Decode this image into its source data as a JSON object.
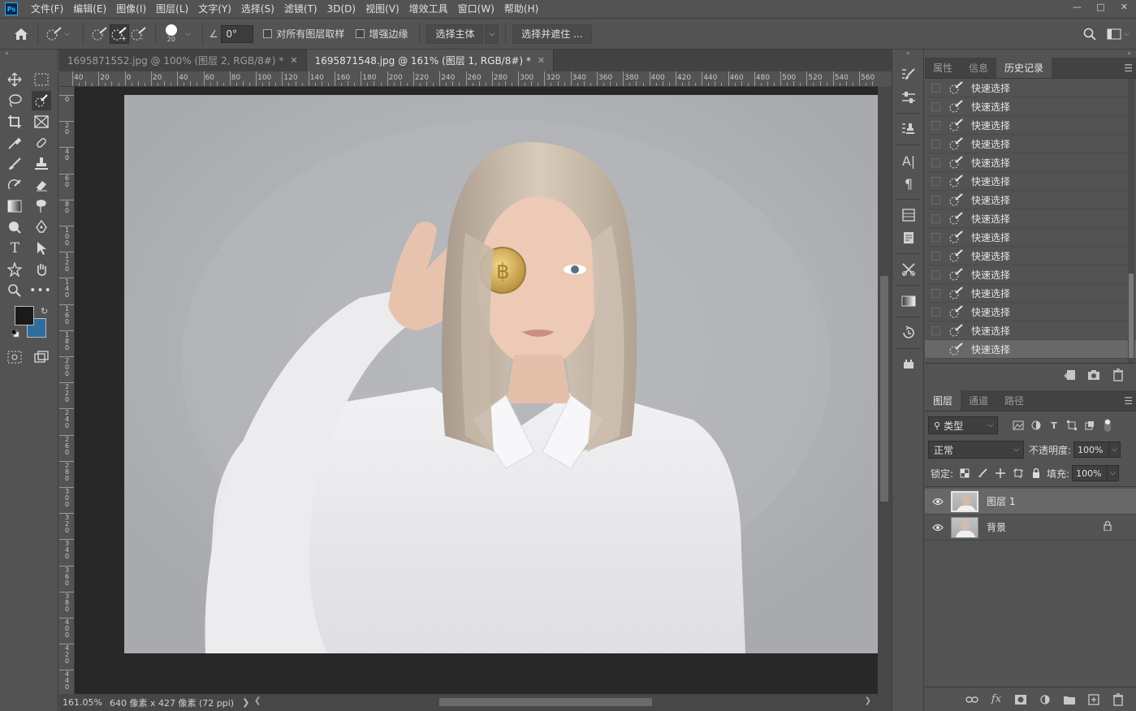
{
  "app": {
    "logo_text": "Ps",
    "menu": [
      "文件(F)",
      "编辑(E)",
      "图像(I)",
      "图层(L)",
      "文字(Y)",
      "选择(S)",
      "滤镜(T)",
      "3D(D)",
      "视图(V)",
      "增效工具",
      "窗口(W)",
      "帮助(H)"
    ]
  },
  "options": {
    "brush_size": "20",
    "angle": "0°",
    "sample_all_layers": "对所有图层取样",
    "enhance_edge": "增强边缘",
    "select_subject": "选择主体",
    "select_and_mask": "选择并遮住 ..."
  },
  "tabs": [
    {
      "label": "1695871552.jpg @ 100% (图层 2, RGB/8#) *",
      "active": false
    },
    {
      "label": "1695871548.jpg @ 161% (图层 1, RGB/8#) *",
      "active": true
    }
  ],
  "ruler": {
    "h_labels": [
      "40",
      "20",
      "0",
      "20",
      "40",
      "60",
      "80",
      "100",
      "120",
      "140",
      "160",
      "180",
      "200",
      "220",
      "240",
      "260",
      "280",
      "300",
      "320",
      "340",
      "360",
      "380",
      "400",
      "420",
      "440",
      "460",
      "480",
      "500",
      "520",
      "540",
      "560"
    ],
    "v_labels": [
      "0",
      "2 0",
      "4 0",
      "6 0",
      "8 0",
      "1 0 0",
      "1 2 0",
      "1 4 0",
      "1 6 0",
      "1 8 0",
      "2 0 0",
      "2 2 0",
      "2 4 0",
      "2 6 0",
      "2 8 0",
      "3 0 0",
      "3 2 0",
      "3 4 0",
      "3 6 0",
      "3 8 0",
      "4 0 0",
      "4 2 0",
      "4 4 0"
    ]
  },
  "status": {
    "zoom": "161.05%",
    "doc_size": "640 像素 x 427 像素 (72 ppi)"
  },
  "panels": {
    "top_tabs": [
      "属性",
      "信息",
      "历史记录"
    ],
    "history": {
      "items": [
        "快速选择",
        "快速选择",
        "快速选择",
        "快速选择",
        "快速选择",
        "快速选择",
        "快速选择",
        "快速选择",
        "快速选择",
        "快速选择",
        "快速选择",
        "快速选择",
        "快速选择",
        "快速选择",
        "快速选择"
      ],
      "current_index": 14
    },
    "layer_tabs": [
      "图层",
      "通道",
      "路径"
    ],
    "layers": {
      "filter_kind": "类型",
      "blend_mode": "正常",
      "opacity_label": "不透明度:",
      "opacity": "100%",
      "lock_label": "锁定:",
      "fill_label": "填充:",
      "fill": "100%",
      "items": [
        {
          "name": "图层 1",
          "selected": true,
          "locked": false
        },
        {
          "name": "背景",
          "selected": false,
          "locked": true
        }
      ]
    }
  },
  "colors": {
    "foreground": "#1a1a1a",
    "background": "#2e6e9e",
    "accent": "#31a8ff"
  }
}
